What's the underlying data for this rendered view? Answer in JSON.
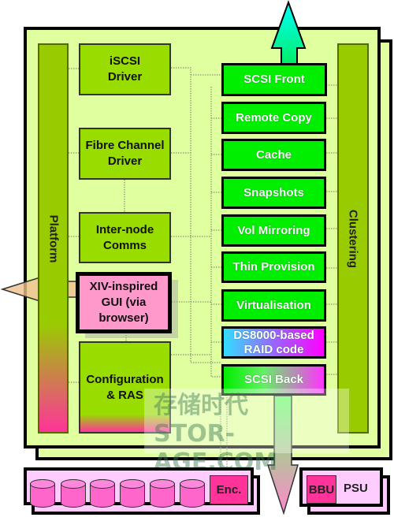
{
  "platform": {
    "label": "Platform"
  },
  "clustering": {
    "label": "Clustering"
  },
  "left_boxes": [
    {
      "label": "iSCSI Driver"
    },
    {
      "label": "Fibre Channel Driver"
    },
    {
      "label": "Inter-node Comms"
    },
    {
      "label": "XIV-inspired GUI (via browser)"
    },
    {
      "label": "Configuration & RAS"
    }
  ],
  "stack": [
    {
      "label": "SCSI Front"
    },
    {
      "label": "Remote Copy"
    },
    {
      "label": "Cache"
    },
    {
      "label": "Snapshots"
    },
    {
      "label": "Vol Mirroring"
    },
    {
      "label": "Thin Provision"
    },
    {
      "label": "Virtualisation"
    },
    {
      "label": "DS8000-based RAID code"
    },
    {
      "label": "SCSI Back"
    }
  ],
  "enclosure": {
    "label": "Enc."
  },
  "power": {
    "bbu": "BBU",
    "psu": "PSU"
  },
  "watermark": "存储时代 STOR-AGE.COM",
  "colors": {
    "panel": "#e0ff9f",
    "module": "#00ee00",
    "driver": "#99dd00",
    "gui": "#ff99cc",
    "enclosure": "#ffccff",
    "accent": "#ff3399"
  }
}
